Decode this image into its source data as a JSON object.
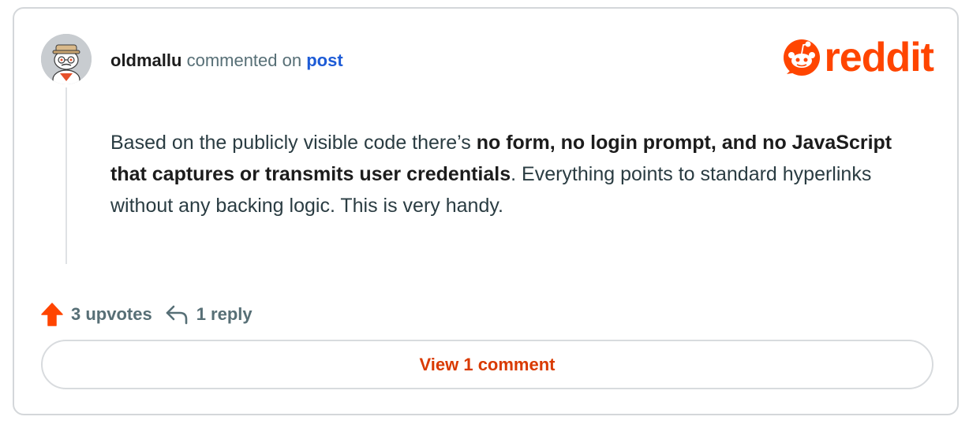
{
  "comment": {
    "author": "oldmallu",
    "action_text": "commented on",
    "target_link": "post",
    "body": {
      "part1": "Based on the publicly visible code there’s ",
      "bold1": "no form, no login prompt, and no JavaScript that captures or transmits user credentials",
      "part2": ". Everything points to standard hyperlinks without any backing logic. This is very handy."
    }
  },
  "brand": {
    "name": "reddit",
    "color": "#ff4500"
  },
  "actions": {
    "upvotes_label": "3 upvotes",
    "upvote_icon": "upvote-arrow-icon",
    "upvote_color": "#ff4500",
    "reply_label": "1 reply",
    "reply_icon": "reply-arrow-icon"
  },
  "view_button": {
    "label": "View 1 comment",
    "color": "#d93a00"
  },
  "avatar": {
    "icon": "snoo-avatar-icon"
  }
}
